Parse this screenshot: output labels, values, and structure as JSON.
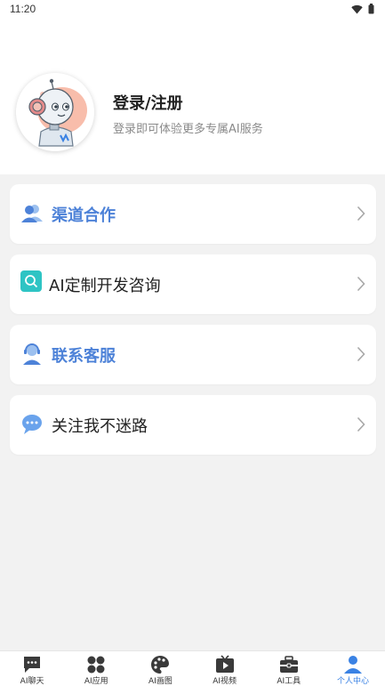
{
  "status_bar": {
    "time": "11:20",
    "icons": [
      "wifi-icon",
      "battery-icon"
    ]
  },
  "profile": {
    "title": "登录/注册",
    "subtitle": "登录即可体验更多专属AI服务",
    "avatar_icon": "robot-avatar-icon"
  },
  "menu": [
    {
      "label": "渠道合作",
      "icon": "users-icon",
      "style": "blue"
    },
    {
      "label": "AI定制开发咨询",
      "icon": "search-square-icon",
      "style": "normal"
    },
    {
      "label": "联系客服",
      "icon": "customer-service-icon",
      "style": "blue"
    },
    {
      "label": "关注我不迷路",
      "icon": "chat-bubble-icon",
      "style": "normal"
    }
  ],
  "tabbar": {
    "items": [
      {
        "label": "AI聊天",
        "icon": "chat-icon",
        "active": false
      },
      {
        "label": "AI应用",
        "icon": "apps-icon",
        "active": false
      },
      {
        "label": "AI画图",
        "icon": "palette-icon",
        "active": false
      },
      {
        "label": "AI视频",
        "icon": "tv-play-icon",
        "active": false
      },
      {
        "label": "AI工具",
        "icon": "toolbox-icon",
        "active": false
      },
      {
        "label": "个人中心",
        "icon": "person-icon",
        "active": true
      }
    ]
  },
  "colors": {
    "accent": "#3a82e4",
    "blue_label": "#4d82d8",
    "teal_icon": "#2ec4c4"
  }
}
